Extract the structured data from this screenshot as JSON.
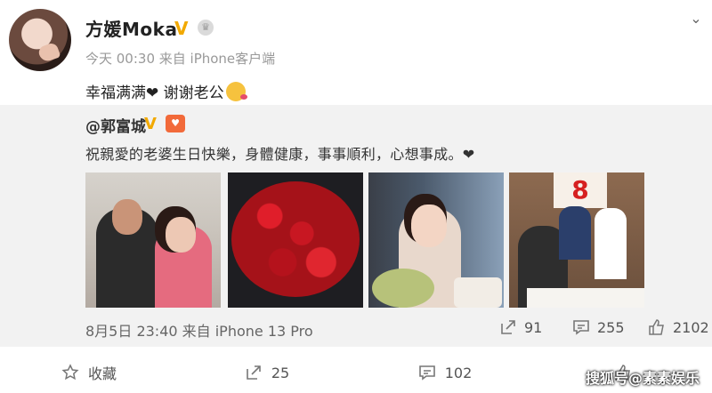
{
  "author": {
    "name": "方媛Moka",
    "verified_mark": "V",
    "meta": "今天 00:30 来自 iPhone客户端"
  },
  "post": {
    "text": "幸福满满❤ 谢谢老公"
  },
  "repost": {
    "author": "@郭富城",
    "verified_mark": "V",
    "text": "祝親愛的老婆生日快樂，身體健康，事事順利，心想事成。❤",
    "meta": "8月5日 23:40 来自 iPhone 13 Pro",
    "forwards": "91",
    "comments": "255",
    "likes": "2102",
    "banner_text": "8"
  },
  "footer": {
    "favorite_label": "收藏",
    "forward_count": "25",
    "comment_count": "102"
  },
  "watermark": "搜狐号@素素娱乐",
  "icons": {
    "dropdown": "chevron-down-icon",
    "forward": "share-icon",
    "comment": "comment-icon",
    "like": "thumbs-up-icon",
    "favorite": "star-icon"
  },
  "colors": {
    "verified": "#f2a900",
    "repost_bg": "#f2f2f2"
  }
}
